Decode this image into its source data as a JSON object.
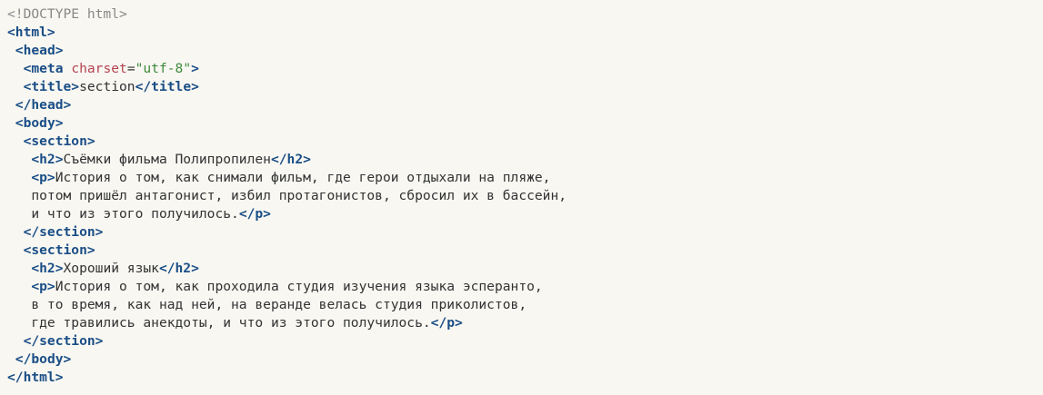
{
  "code": {
    "l0": {
      "doctype": "<!DOCTYPE html>"
    },
    "l1": {
      "open": "<html>"
    },
    "l2": {
      "open": "<head>"
    },
    "l3": {
      "open": "<meta",
      "attr": "charset",
      "eq": "=",
      "value": "\"utf-8\"",
      "close": ">"
    },
    "l4": {
      "open": "<title>",
      "text": "section",
      "close": "</title>"
    },
    "l5": {
      "close": "</head>"
    },
    "l6": {
      "open": "<body>"
    },
    "l7": {
      "open": "<section>"
    },
    "l8": {
      "open": "<h2>",
      "text": "Съёмки фильма Полипропилен",
      "close": "</h2>"
    },
    "l9": {
      "open": "<p>",
      "text": "История о том, как снимали фильм, где герои отдыхали на пляже,"
    },
    "l10": {
      "text": "потом пришёл антагонист, избил протагонистов, сбросил их в бассейн,"
    },
    "l11": {
      "text": "и что из этого получилось.",
      "close": "</p>"
    },
    "l12": {
      "close": "</section>"
    },
    "l13": {
      "open": "<section>"
    },
    "l14": {
      "open": "<h2>",
      "text": "Хороший язык",
      "close": "</h2>"
    },
    "l15": {
      "open": "<p>",
      "text": "История о том, как проходила студия изучения языка эсперанто,"
    },
    "l16": {
      "text": "в то время, как над ней, на веранде велась студия приколистов,"
    },
    "l17": {
      "text": "где травились анекдоты, и что из этого получилось.",
      "close": "</p>"
    },
    "l18": {
      "close": "</section>"
    },
    "l19": {
      "close": "</body>"
    },
    "l20": {
      "close": "</html>"
    }
  }
}
